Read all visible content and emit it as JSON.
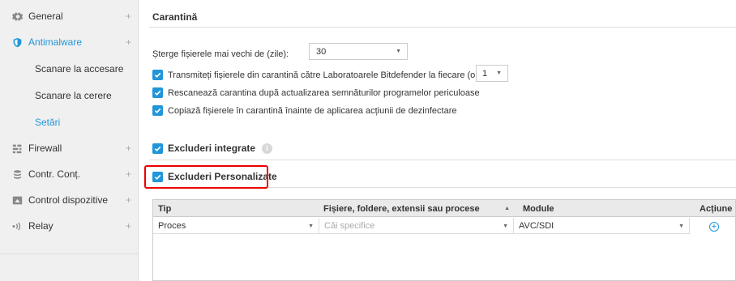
{
  "sidebar": {
    "items": [
      {
        "label": "General",
        "icon": "gear-icon",
        "expand": "+"
      },
      {
        "label": "Antimalware",
        "icon": "shield-icon",
        "expand": "+"
      },
      {
        "label": "Firewall",
        "icon": "firewall-icon",
        "expand": "+"
      },
      {
        "label": "Contr. Conț.",
        "icon": "database-icon",
        "expand": "+"
      },
      {
        "label": "Control dispozitive",
        "icon": "device-icon",
        "expand": "+"
      },
      {
        "label": "Relay",
        "icon": "relay-icon",
        "expand": "+"
      }
    ],
    "subitems": [
      {
        "label": "Scanare la accesare"
      },
      {
        "label": "Scanare la cerere"
      },
      {
        "label": "Setări"
      }
    ]
  },
  "main": {
    "section_title": "Carantină",
    "delete_label": "Șterge fișierele mai vechi de (zile):",
    "delete_value": "30",
    "checkbox_send": "Transmiteți fișierele din carantină către Laboratoarele Bitdefender la fiecare (ore)",
    "send_hours": "1",
    "checkbox_rescan": "Rescanează carantina după actualizarea semnăturilor programelor periculoase",
    "checkbox_copy": "Copiază fișierele în carantină înainte de aplicarea acțiunii de dezinfectare",
    "builtin_exclusions": "Excluderi integrate",
    "custom_exclusions": "Excluderi Personalizate"
  },
  "table": {
    "headers": {
      "type": "Tip",
      "files": "Fișiere, foldere, extensii sau procese",
      "module": "Module",
      "action": "Acțiune"
    },
    "row": {
      "type": "Proces",
      "files_placeholder": "Căi specifice",
      "module": "AVC/SDI"
    },
    "add_symbol": "+"
  },
  "colors": {
    "accent": "#2196d9",
    "highlight": "#e00000"
  }
}
